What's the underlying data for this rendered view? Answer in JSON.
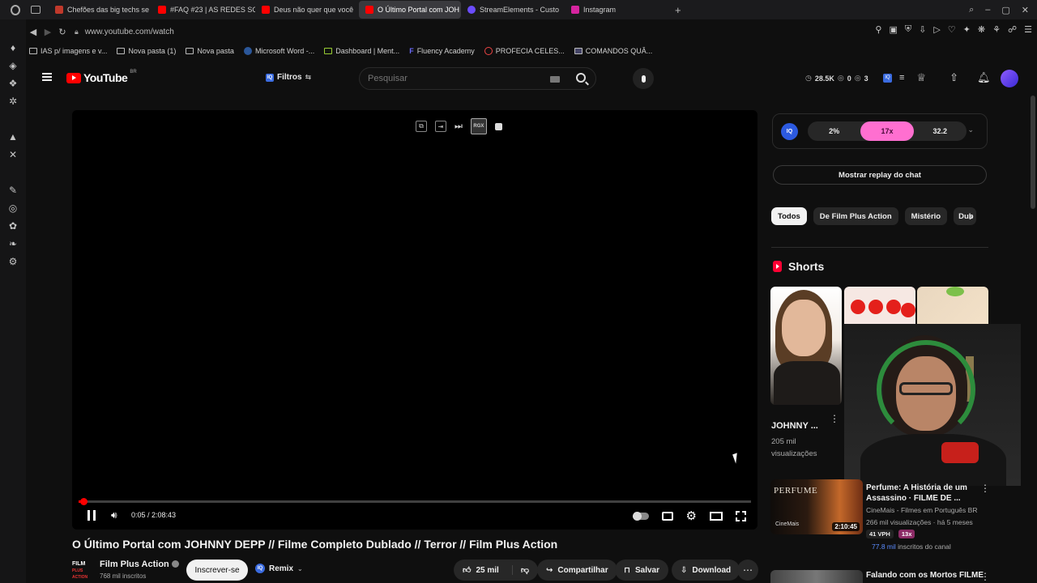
{
  "browser": {
    "tabs": [
      {
        "label": "Chefões das big techs se",
        "color": "#c0392b"
      },
      {
        "label": "#FAQ #23 | AS REDES SO",
        "color": "#ff0000"
      },
      {
        "label": "Deus não quer que você",
        "color": "#ff0000"
      },
      {
        "label": "O Último Portal com JOH",
        "color": "#ff0000",
        "active": true
      },
      {
        "label": "StreamElements - Custo",
        "color": "#6b4cff"
      },
      {
        "label": "Instagram",
        "color": "#d6249f"
      }
    ],
    "new_tab": "+",
    "url": "www.youtube.com/watch",
    "bookmarks": [
      "IAS p/ imagens e v...",
      "Nova pasta (1)",
      "Nova pasta",
      "Microsoft Word -...",
      "Dashboard | Ment...",
      "Fluency Academy",
      "PROFECIA CELES...",
      "COMANDOS QUÂ..."
    ]
  },
  "header": {
    "logo_text": "YouTube",
    "region": "BR",
    "filtros_label": "Filtros",
    "iq_label": "IQ",
    "search_placeholder": "Pesquisar",
    "stats": {
      "views": "28.5K",
      "likes": "0",
      "comments": "3"
    }
  },
  "player": {
    "progress": 0.0004,
    "time": "0:05 / 2:08:43",
    "rgx_label": "RGX"
  },
  "video": {
    "title": "O Último Portal com JOHNNY DEPP // Filme Completo Dublado // Terror // Film Plus Action",
    "channel_logo_top": "FILM",
    "channel_logo_bottom": "PLUS ACTION",
    "channel": "Film Plus Action",
    "subscribers": "768 mil inscritos",
    "subscribe_label": "Inscrever-se",
    "remix_label": "Remix",
    "likes": "25 mil",
    "share_label": "Compartilhar",
    "save_label": "Salvar",
    "download_label": "Download"
  },
  "sidebar": {
    "iq_panel": {
      "badge": "IQ",
      "stat1": "2%",
      "stat2": "17x",
      "stat3": "32.2"
    },
    "chat_replay_label": "Mostrar replay do chat",
    "chips": [
      "Todos",
      "De Film Plus Action",
      "Mistério",
      "Dub"
    ],
    "shorts_title": "Shorts",
    "short1": {
      "title": "JOHNNY ...",
      "views": "205 mil visualizações"
    },
    "rec1": {
      "thumb_brand": "PERFUME",
      "thumb_brand2": "CineMais",
      "duration": "2:10:45",
      "title": "Perfume: A História de um Assassino · FILME DE ...",
      "channel": "CineMais - Filmes em Português BR",
      "meta": "266 mil visualizações · há 5 meses",
      "vph": "41 VPH",
      "mult": "13x",
      "subs_value": "77.8 mil",
      "subs_suffix": " inscritos do canal"
    },
    "rec2": {
      "title": "Falando com os Mortos FILME"
    }
  }
}
